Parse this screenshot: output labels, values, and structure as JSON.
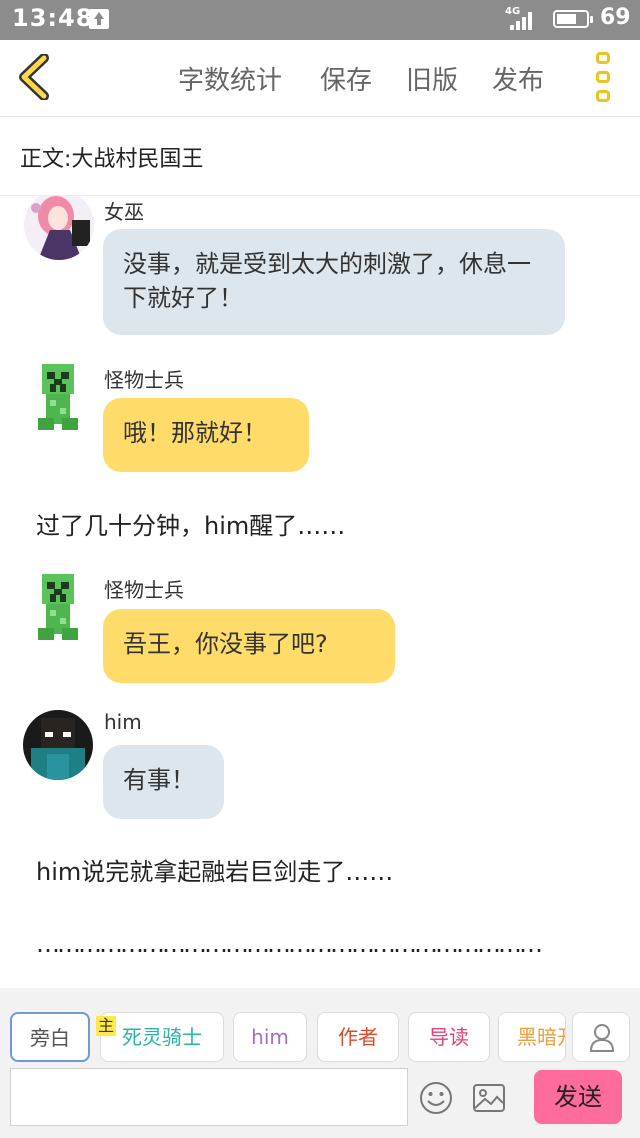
{
  "status_bar": {
    "time": "13:48",
    "network": "4G",
    "battery_percent": "69",
    "battery_level": 0.69
  },
  "toolbar": {
    "word_count_label": "字数统计",
    "save_label": "保存",
    "old_version_label": "旧版",
    "publish_label": "发布"
  },
  "chapter_title": "正文:大战村民国王",
  "messages": [
    {
      "speaker": "女巫",
      "text": "没事，就是受到太大的刺激了，休息一下就好了！"
    },
    {
      "speaker": "怪物士兵",
      "text": "哦！那就好！"
    },
    {
      "narration": "过了几十分钟，him醒了……"
    },
    {
      "speaker": "怪物士兵",
      "text": "吾王，你没事了吧?"
    },
    {
      "speaker": "him",
      "text": "有事！"
    },
    {
      "narration": "him说完就拿起融岩巨剑走了……"
    },
    {
      "narration": "………………………………………………………………"
    }
  ],
  "characters": {
    "chips": [
      {
        "label": "旁白",
        "color": "#555555"
      },
      {
        "label": "死灵骑士",
        "color": "#2bb3a6"
      },
      {
        "label": "him",
        "color": "#a66cc8"
      },
      {
        "label": "作者",
        "color": "#d94b2b"
      },
      {
        "label": "导读",
        "color": "#e0407c"
      },
      {
        "label": "黑暗开",
        "color": "#e8a040"
      }
    ],
    "protagonist_badge": "主"
  },
  "composer": {
    "placeholder": "",
    "value": "",
    "send_label": "发送"
  }
}
